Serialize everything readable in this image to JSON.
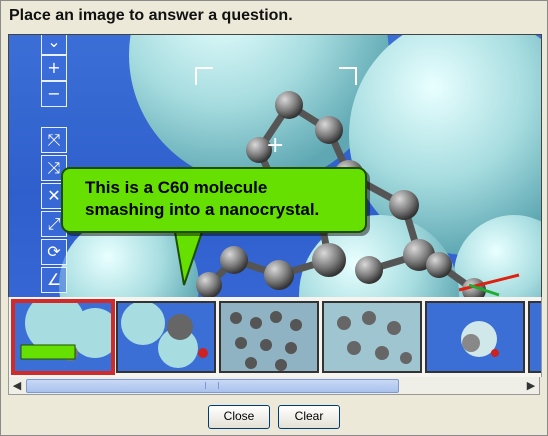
{
  "dialog": {
    "title": "Place an image to answer a question."
  },
  "viewer": {
    "caption_line1": "This is a C60 molecule",
    "caption_line2": "smashing into a nanocrystal."
  },
  "thumbnails": {
    "selected_index": 0,
    "count_visible": 5
  },
  "scrollbar": {
    "left_arrow_icon": "arrow-left-icon",
    "right_arrow_icon": "arrow-right-icon"
  },
  "buttons": {
    "close_label": "Close",
    "clear_label": "Clear"
  },
  "colors": {
    "bubble": "#66e000",
    "selection": "#d12a2a",
    "background": "#ece9d8"
  }
}
